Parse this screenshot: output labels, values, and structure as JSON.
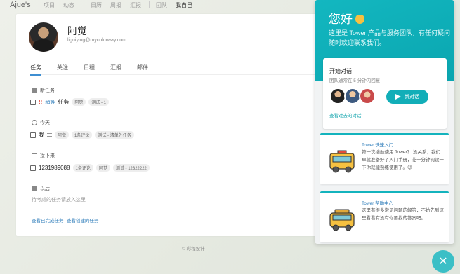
{
  "nav": {
    "brand": "Ajue's",
    "items": [
      "项目",
      "动态",
      "日历",
      "周报",
      "汇报",
      "团队",
      "我自己"
    ]
  },
  "profile": {
    "name": "阿觉",
    "email": "liguiying@mycolorway.com"
  },
  "tabs": [
    "任务",
    "关注",
    "日程",
    "汇报",
    "邮件"
  ],
  "sections": {
    "new": {
      "label": "新任务",
      "task": {
        "marker": "!!",
        "category": "稍等",
        "text": "任务",
        "tags": [
          "阿觉",
          "测试 - 1"
        ]
      }
    },
    "today": {
      "label": "今天",
      "task": {
        "text": "我",
        "tags": [
          "阿觉",
          "1条评论",
          "测试 - 清单外任务"
        ]
      }
    },
    "upcoming": {
      "label": "接下来",
      "task": {
        "text": "1231989088",
        "tags": [
          "1条评论",
          "阿觉",
          "测试 - 12322222"
        ]
      }
    },
    "later": {
      "label": "以后",
      "empty": "待考虑的任务请放入这里"
    }
  },
  "links": {
    "done": "查看已完成任务",
    "created": "查看创建的任务"
  },
  "footer": "© 彩程设计",
  "panel": {
    "hello": "您好",
    "subtitle": "这里是 Tower 产品与服务团队，有任何疑问随时欢迎联系我们。",
    "conversation": {
      "title": "开始对话",
      "subtitle": "团队通常在 5 分钟内回复",
      "new_button": "新对话",
      "history_link": "查看过去的对话"
    },
    "articles": [
      {
        "title": "Tower 快速入门",
        "body": "第一次接触使用 Tower？ 没关系，我们早就准备好了入门手册，花十分钟阅读一下你就能熟练使用了。😉"
      },
      {
        "title": "Tower 帮助中心",
        "body": "这里有很多常见问题的解答，不妨先到这里看看有没有你要找的答案吧。"
      }
    ]
  },
  "colors": {
    "accent": "#13b7c0",
    "link": "#2b7bb9",
    "urgent": "#e24b3b"
  }
}
